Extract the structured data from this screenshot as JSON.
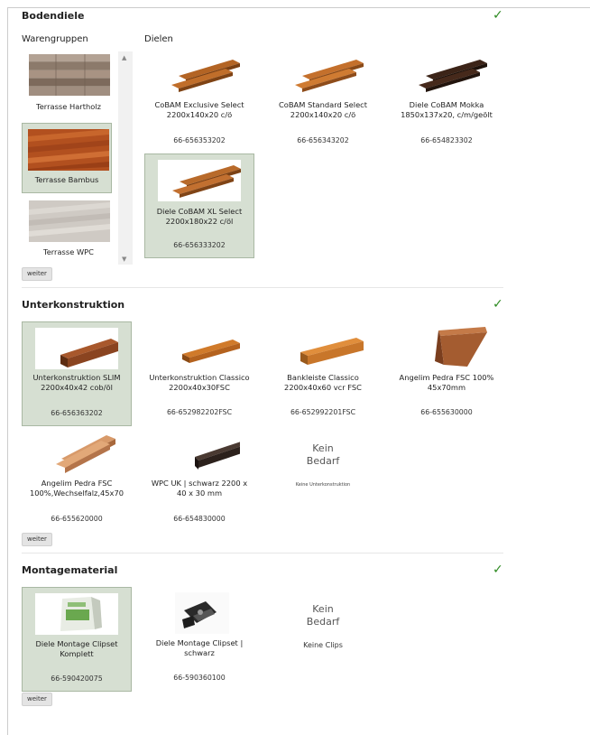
{
  "sections": {
    "bodendiele": {
      "title": "Bodendiele",
      "check_icon": "checkmark-icon",
      "warengruppen": {
        "title": "Warengruppen",
        "items": [
          {
            "label": "Terrasse Hartholz",
            "selected": false
          },
          {
            "label": "Terrasse Bambus",
            "selected": true
          },
          {
            "label": "Terrasse WPC",
            "selected": false
          }
        ]
      },
      "dielen": {
        "title": "Dielen",
        "items": [
          {
            "name": "CoBAM Exclusive Select 2200x140x20 c/ö",
            "number": "66-656353202",
            "selected": false
          },
          {
            "name": "CoBAM Standard Select 2200x140x20 c/ö",
            "number": "66-656343202",
            "selected": false
          },
          {
            "name": "Diele CoBAM Mokka 1850x137x20, c/m/geölt",
            "number": "66-654823302",
            "selected": false
          },
          {
            "name": "Diele CoBAM XL Select 2200x180x22 c/öl",
            "number": "66-656333202",
            "selected": true
          }
        ]
      },
      "button": "weiter"
    },
    "unterkonstruktion": {
      "title": "Unterkonstruktion",
      "items": [
        {
          "name": "Unterkonstruktion SLIM 2200x40x42 cob/öl",
          "number": "66-656363202",
          "selected": true
        },
        {
          "name": "Unterkonstruktion Classico 2200x40x30FSC",
          "number": "66-652982202FSC",
          "selected": false
        },
        {
          "name": "Bankleiste Classico 2200x40x60 vcr FSC",
          "number": "66-652992201FSC",
          "selected": false
        },
        {
          "name": "Angelim Pedra FSC 100% 45x70mm",
          "number": "66-655630000",
          "selected": false
        },
        {
          "name": "Angelim Pedra FSC 100%,Wechselfalz,45x70",
          "number": "66-655620000",
          "selected": false
        },
        {
          "name": "WPC UK | schwarz 2200 x 40 x 30 mm",
          "number": "66-654830000",
          "selected": false
        }
      ],
      "kein": {
        "line1": "Kein",
        "line2": "Bedarf",
        "caption": "Keine Unterkonstruktion"
      },
      "button": "weiter"
    },
    "montagematerial": {
      "title": "Montagematerial",
      "items": [
        {
          "name": "Diele Montage Clipset Komplett",
          "number": "66-590420075",
          "selected": true
        },
        {
          "name": "Diele Montage Clipset | schwarz",
          "number": "66-590360100",
          "selected": false
        }
      ],
      "kein": {
        "line1": "Kein",
        "line2": "Bedarf",
        "caption": "Keine Clips"
      },
      "button": "weiter"
    }
  }
}
